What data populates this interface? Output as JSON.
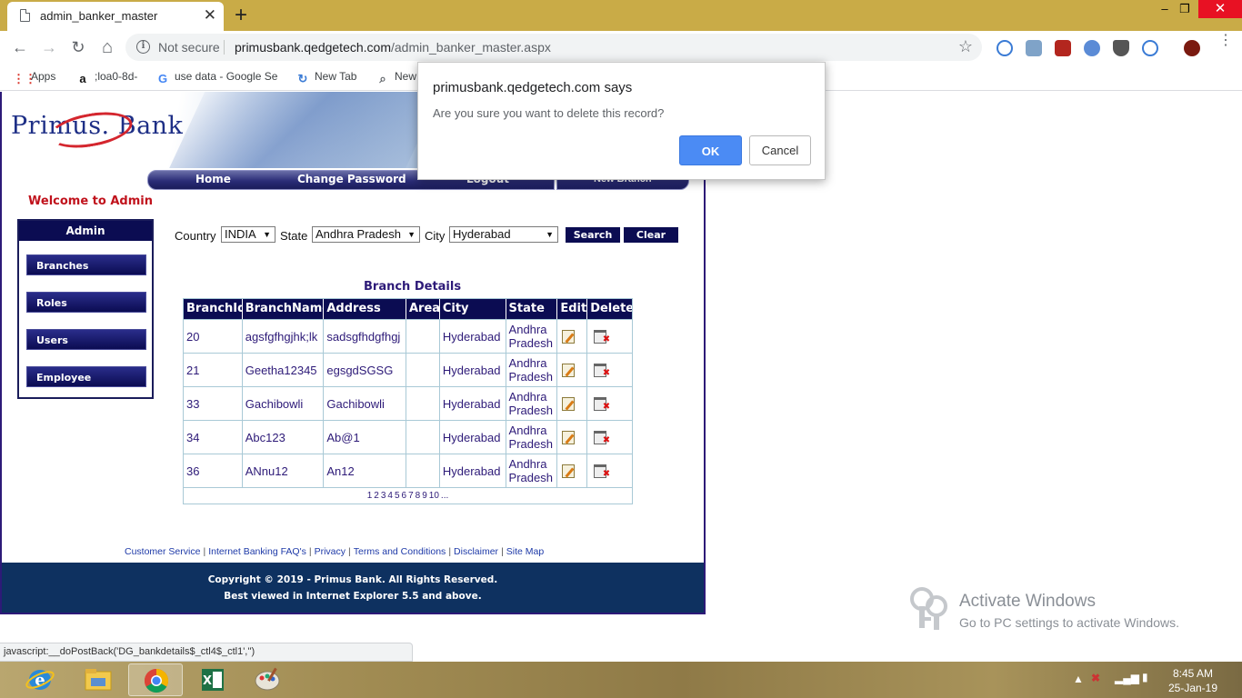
{
  "browser": {
    "tab_title": "admin_banker_master",
    "tab_close": "✕",
    "new_tab": "+",
    "window_controls": {
      "minimize": "–",
      "maximize": "❐",
      "close": "✕"
    },
    "nav": {
      "back": "←",
      "forward": "→",
      "reload": "↻",
      "home": "⌂"
    },
    "security_label": "Not secure",
    "url_host": "primusbank.qedgetech.com",
    "url_path": "/admin_banker_master.aspx",
    "bookmarks": [
      {
        "icon": "apps-grid-icon",
        "label": "Apps"
      },
      {
        "icon": "amazon-icon",
        "label": ";loa0-8d-"
      },
      {
        "icon": "google-icon",
        "label": "use data - Google Se"
      },
      {
        "icon": "sync-icon",
        "label": "New Tab"
      },
      {
        "icon": "search-icon",
        "label": "New"
      }
    ]
  },
  "site": {
    "logo_primary": "Primus.",
    "logo_secondary": "Bank",
    "nav": [
      "Home",
      "Change Password",
      "Logout"
    ],
    "nav_extra": "New Branch",
    "welcome": "Welcome to Admin",
    "admin_menu": {
      "title": "Admin",
      "items": [
        "Branches",
        "Roles",
        "Users",
        "Employee"
      ]
    },
    "filters": {
      "country_label": "Country",
      "country_value": "INDIA",
      "state_label": "State",
      "state_value": "Andhra Pradesh",
      "city_label": "City",
      "city_value": "Hyderabad",
      "search_label": "Search",
      "clear_label": "Clear"
    },
    "table": {
      "title": "Branch Details",
      "columns": [
        "BranchId",
        "BranchName",
        "Address",
        "Area",
        "City",
        "State",
        "Edit",
        "Delete"
      ],
      "rows": [
        {
          "id": "20",
          "name": "agsfgfhgjhk;lk",
          "address": "sadsgfhdgfhgj",
          "area": "",
          "city": "Hyderabad",
          "state": "Andhra Pradesh"
        },
        {
          "id": "21",
          "name": "Geetha12345",
          "address": "egsgdSGSG",
          "area": "",
          "city": "Hyderabad",
          "state": "Andhra Pradesh"
        },
        {
          "id": "33",
          "name": "Gachibowli",
          "address": "Gachibowli",
          "area": "",
          "city": "Hyderabad",
          "state": "Andhra Pradesh"
        },
        {
          "id": "34",
          "name": "Abc123",
          "address": "Ab@1",
          "area": "",
          "city": "Hyderabad",
          "state": "Andhra Pradesh"
        },
        {
          "id": "36",
          "name": "ANnu12",
          "address": "An12",
          "area": "",
          "city": "Hyderabad",
          "state": "Andhra Pradesh"
        }
      ],
      "pager": [
        "1",
        "2",
        "3",
        "4",
        "5",
        "6",
        "7",
        "8",
        "9",
        "10",
        "..."
      ]
    },
    "footer_links": [
      "Customer Service",
      "Internet Banking FAQ's",
      "Privacy",
      "Terms and Conditions",
      "Disclaimer",
      "Site Map"
    ],
    "copyright": "Copyright © 2019 - Primus Bank. All Rights Reserved.",
    "best_viewed": "Best viewed in Internet Explorer 5.5 and above."
  },
  "status_bar": "javascript:__doPostBack('DG_bankdetails$_ctl4$_ctl1','')",
  "dialog": {
    "origin": "primusbank.qedgetech.com says",
    "message": "Are you sure you want to delete this record?",
    "ok": "OK",
    "cancel": "Cancel"
  },
  "watermark": {
    "title": "Activate Windows",
    "subtitle": "Go to PC settings to activate Windows."
  },
  "taskbar": {
    "apps": [
      "internet-explorer-icon",
      "file-explorer-icon",
      "chrome-icon",
      "excel-icon",
      "paint-icon"
    ],
    "time": "8:45 AM",
    "date": "25-Jan-19"
  }
}
